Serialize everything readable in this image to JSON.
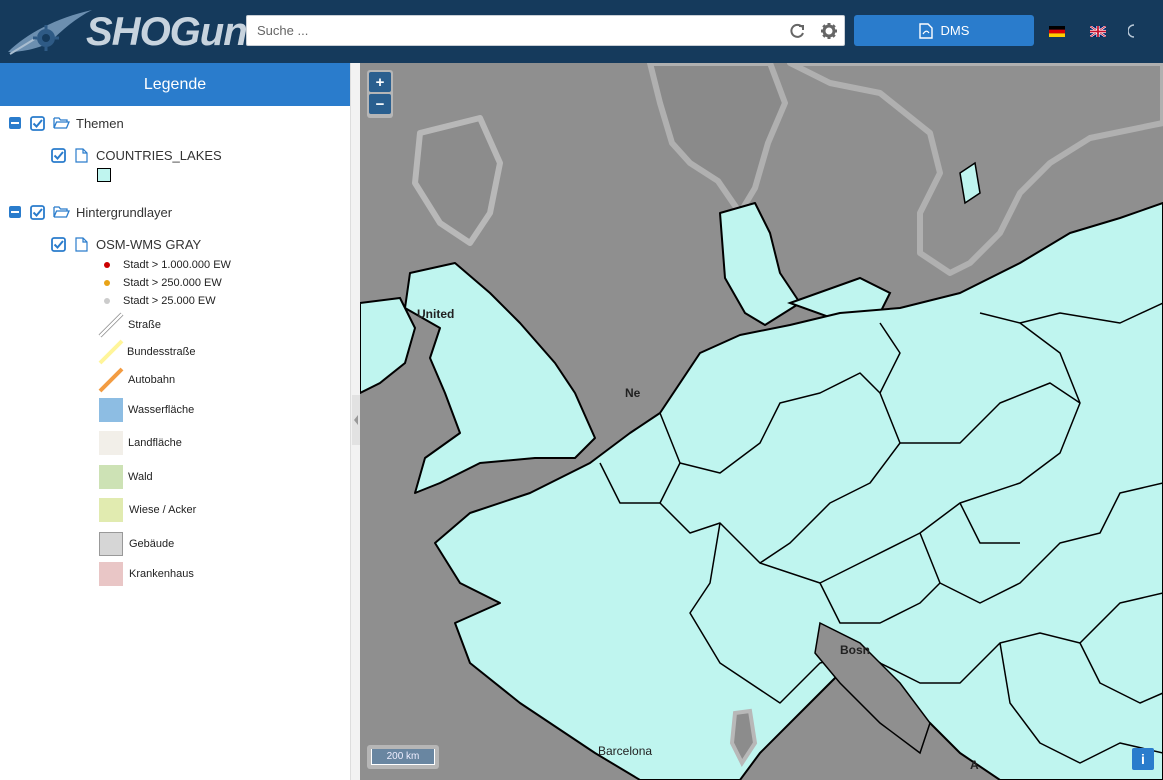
{
  "header": {
    "logo_text": "SHOGun",
    "search_placeholder": "Suche ...",
    "dms_label": "DMS",
    "lang_flags": [
      "de",
      "en"
    ]
  },
  "legend": {
    "title": "Legende",
    "groups": [
      {
        "label": "Themen",
        "layers": [
          {
            "label": "COUNTRIES_LAKES"
          }
        ]
      },
      {
        "label": "Hintergrundlayer",
        "layers": [
          {
            "label": "OSM-WMS GRAY"
          }
        ]
      }
    ],
    "osm_items": [
      {
        "label": "Stadt > 1.000.000 EW",
        "kind": "dot",
        "color": "#cc0000"
      },
      {
        "label": "Stadt > 250.000 EW",
        "kind": "dot",
        "color": "#e8a317"
      },
      {
        "label": "Stadt > 25.000 EW",
        "kind": "dot",
        "color": "#cccccc"
      },
      {
        "label": "Straße",
        "kind": "line",
        "color": "#ffffff"
      },
      {
        "label": "Bundesstraße",
        "kind": "line",
        "color": "#fff59a"
      },
      {
        "label": "Autobahn",
        "kind": "line",
        "color": "#f39c42"
      },
      {
        "label": "Wasserfläche",
        "kind": "fill",
        "color": "#8dbde3"
      },
      {
        "label": "Landfläche",
        "kind": "fill",
        "color": "#f2efe9"
      },
      {
        "label": "Wald",
        "kind": "fill",
        "color": "#cde2b5"
      },
      {
        "label": "Wiese / Acker",
        "kind": "fill",
        "color": "#e1ebb0"
      },
      {
        "label": "Gebäude",
        "kind": "fill",
        "color": "#d6d6d6"
      },
      {
        "label": "Krankenhaus",
        "kind": "fill",
        "color": "#e9c6c6"
      }
    ]
  },
  "map": {
    "zoom_in": "+",
    "zoom_out": "−",
    "scale_label": "200 km",
    "info_label": "i",
    "labels": [
      "United",
      "Ne",
      "Bosn",
      "Barcelona",
      "A"
    ],
    "country_fill": "#bff5ef",
    "sea_color": "#8f8f8f"
  },
  "colors": {
    "header_bg": "#153a5c",
    "accent": "#2a7ccc"
  }
}
